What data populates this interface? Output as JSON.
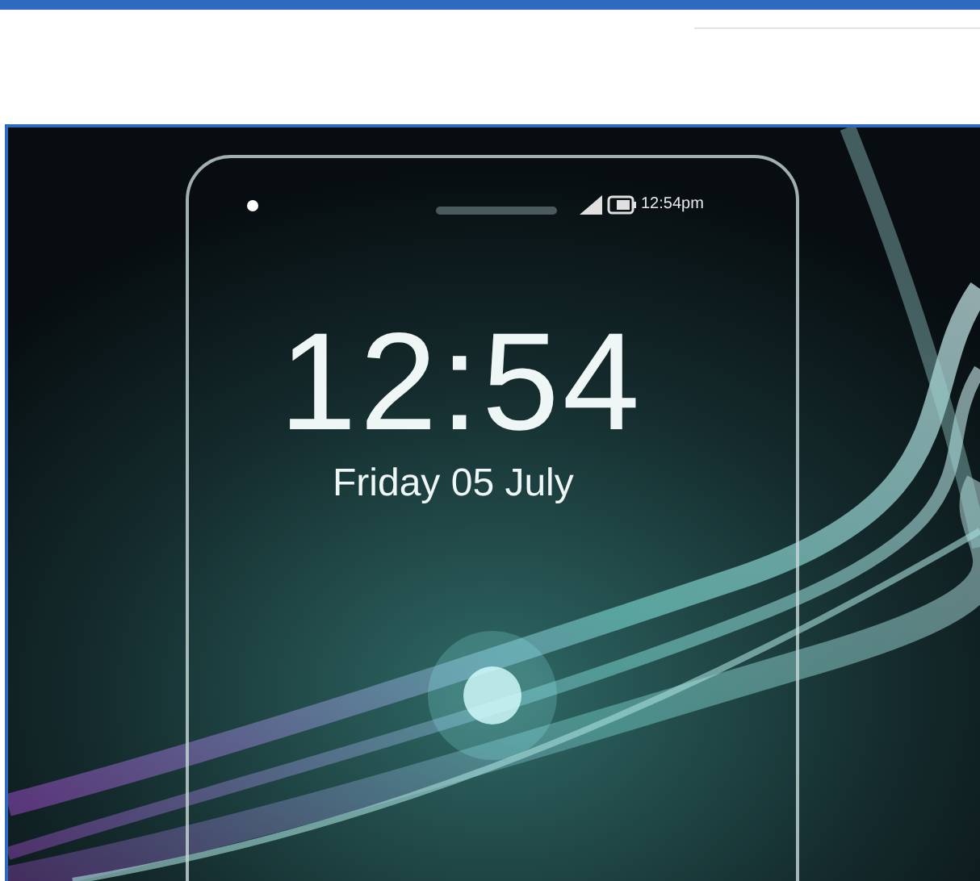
{
  "phone_screen": {
    "status_time": "12:54pm",
    "clock": "12:54",
    "date": "Friday 05 July"
  }
}
